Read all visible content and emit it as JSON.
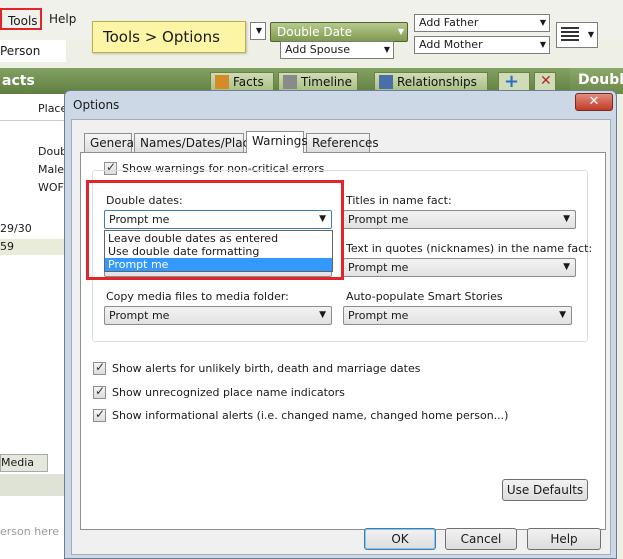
{
  "app": {
    "menu": {
      "tools": "Tools",
      "help": "Help"
    },
    "person_tab": "Person",
    "callout": "Tools > Options",
    "toolbar": {
      "double_date": "Double Date",
      "add_spouse": "Add Spouse",
      "add_father": "Add Father",
      "add_mother": "Add Mother"
    },
    "greenbar": {
      "left_title": "acts",
      "facts": "Facts",
      "timeline": "Timeline",
      "relationships": "Relationships",
      "right_title": "Double"
    },
    "leftpane": {
      "place_header": "Place",
      "facts": [
        "Doub",
        "Male",
        "WOF"
      ],
      "dates": [
        "29/30",
        "59"
      ],
      "media_tab": "Media",
      "search_placeholder": "erson here"
    }
  },
  "dialog": {
    "title": "Options",
    "tabs": [
      "General",
      "Names/Dates/Places",
      "Warnings",
      "References"
    ],
    "active_tab": "Warnings",
    "show_noncritical": "Show warnings for non-critical errors",
    "fields": {
      "double_dates": {
        "label": "Double dates:",
        "value": "Prompt me"
      },
      "titles": {
        "label": "Titles in name fact:",
        "value": "Prompt me"
      },
      "quotes": {
        "label": "Text in quotes (nicknames) in the name fact:",
        "value": "Prompt me"
      },
      "copy_media": {
        "label": "Copy media files to media folder:",
        "value": "Prompt me"
      },
      "smart_stories": {
        "label": "Auto-populate Smart Stories",
        "value": "Prompt me"
      }
    },
    "dropdown_options": [
      "Leave double dates as entered",
      "Use double date formatting",
      "Prompt me"
    ],
    "selected_option": "Prompt me",
    "checkboxes": [
      "Show alerts for unlikely birth, death and marriage dates",
      "Show unrecognized place name indicators",
      "Show informational alerts (i.e. changed name, changed home person...)"
    ],
    "buttons": {
      "use_defaults": "Use Defaults",
      "ok": "OK",
      "cancel": "Cancel",
      "help": "Help"
    },
    "close_glyph": "✕"
  },
  "colors": {
    "highlight": "#e0262a",
    "accent_green": "#6f8f4a",
    "selection": "#3399ff"
  }
}
